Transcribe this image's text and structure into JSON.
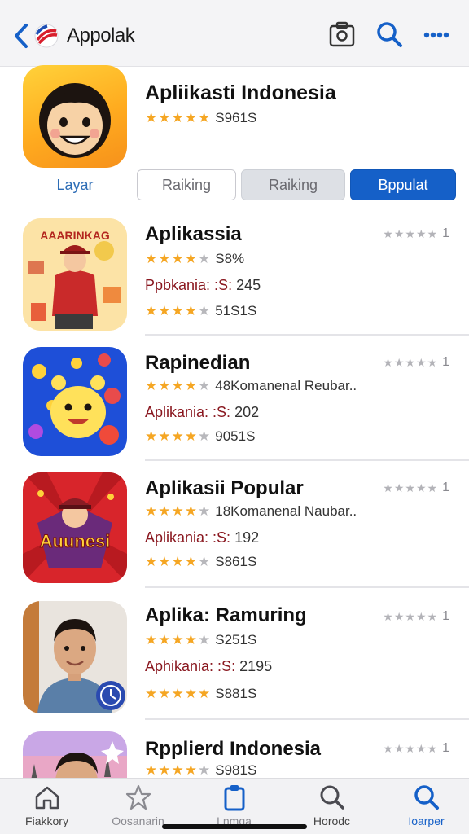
{
  "header": {
    "title": "Appolak",
    "icons": [
      "chevron-left-icon",
      "flag-logo-icon",
      "camera-icon",
      "search-icon",
      "more-icon"
    ],
    "accent_color": "#1560c8"
  },
  "featured": {
    "title": "Apliikasti Indonesia",
    "rating_text": "S961S",
    "stars": 5,
    "label": "Layar",
    "segments": [
      "Raiking",
      "Raiking",
      "Bppulat"
    ],
    "selected_segment": 2
  },
  "apps": [
    {
      "title": "Aplikassia",
      "line1": "S8%",
      "stars1": 4,
      "sub_prefix": "Ppbkania: :S:",
      "sub_value": "245",
      "line3": "51S1S",
      "stars3": 4,
      "mini_count": "1",
      "icon_text": "AAARINKAG"
    },
    {
      "title": "Rapinedian",
      "line1": "48Komanenal Reubar..",
      "stars1": 4,
      "sub_prefix": "Aplikania: :S:",
      "sub_value": "202",
      "line3": "9051S",
      "stars3": 4,
      "mini_count": "1"
    },
    {
      "title": "Aplikasii Popular",
      "line1": "18Komanenal Naubar..",
      "stars1": 4,
      "sub_prefix": "Aplikania: :S:",
      "sub_value": "192",
      "line3": "S861S",
      "stars3": 4,
      "mini_count": "1",
      "icon_text": "Auunesi"
    },
    {
      "title": "Aplika: Ramuring",
      "line1": "S251S",
      "stars1": 4,
      "sub_prefix": "Aphikania: :S:",
      "sub_value": "2195",
      "line3": "S881S",
      "stars3": 5,
      "mini_count": "1"
    },
    {
      "title": "Rpplierd Indonesia",
      "line1": "S981S",
      "stars1": 4,
      "mini_count": "1"
    }
  ],
  "tabbar": {
    "tabs": [
      {
        "label": "Fiakkory",
        "icon": "home-icon"
      },
      {
        "label": "Oosanarin",
        "icon": "star-icon"
      },
      {
        "label": "Lnmga",
        "icon": "clipboard-icon"
      },
      {
        "label": "Horodc",
        "icon": "search-icon"
      },
      {
        "label": "Ioarper",
        "icon": "search-icon"
      }
    ],
    "active_index": 4
  }
}
